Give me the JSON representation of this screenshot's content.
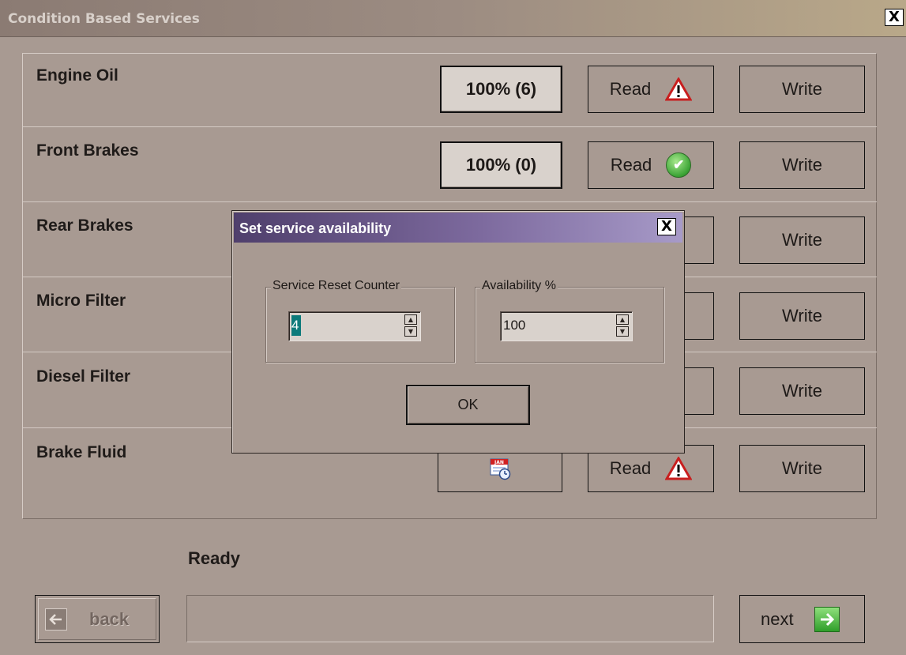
{
  "window": {
    "title": "Condition Based Services",
    "close": "X"
  },
  "rows": [
    {
      "label": "Engine Oil",
      "status": "100% (6)",
      "status_type": "text",
      "read": "Read",
      "read_icon": "warning-icon",
      "write": "Write"
    },
    {
      "label": "Front Brakes",
      "status": "100% (0)",
      "status_type": "text",
      "read": "Read",
      "read_icon": "ok-check-icon",
      "write": "Write"
    },
    {
      "label": "Rear Brakes",
      "status": "",
      "status_type": "hidden",
      "read": "",
      "read_icon": "ok-check-icon",
      "write": "Write"
    },
    {
      "label": "Micro Filter",
      "status": "",
      "status_type": "hidden",
      "read": "",
      "read_icon": "warning-icon",
      "write": "Write"
    },
    {
      "label": "Diesel Filter",
      "status": "",
      "status_type": "hidden",
      "read": "",
      "read_icon": "warning-icon",
      "write": "Write"
    },
    {
      "label": "Brake Fluid",
      "status": "",
      "status_type": "calendar",
      "read": "Read",
      "read_icon": "warning-icon",
      "write": "Write",
      "calendar_text": "JAN"
    }
  ],
  "status_text": "Ready",
  "nav": {
    "back": "back",
    "next": "next"
  },
  "dialog": {
    "title": "Set service availability",
    "close": "X",
    "group_counter": {
      "label": "Service Reset Counter",
      "value": "4"
    },
    "group_availability": {
      "label": "Availability %",
      "value": "100"
    },
    "ok": "OK"
  },
  "colors": {
    "background": "#a89a92",
    "dialog_title_start": "#4f3f6c",
    "dialog_title_end": "#a79ac8"
  }
}
